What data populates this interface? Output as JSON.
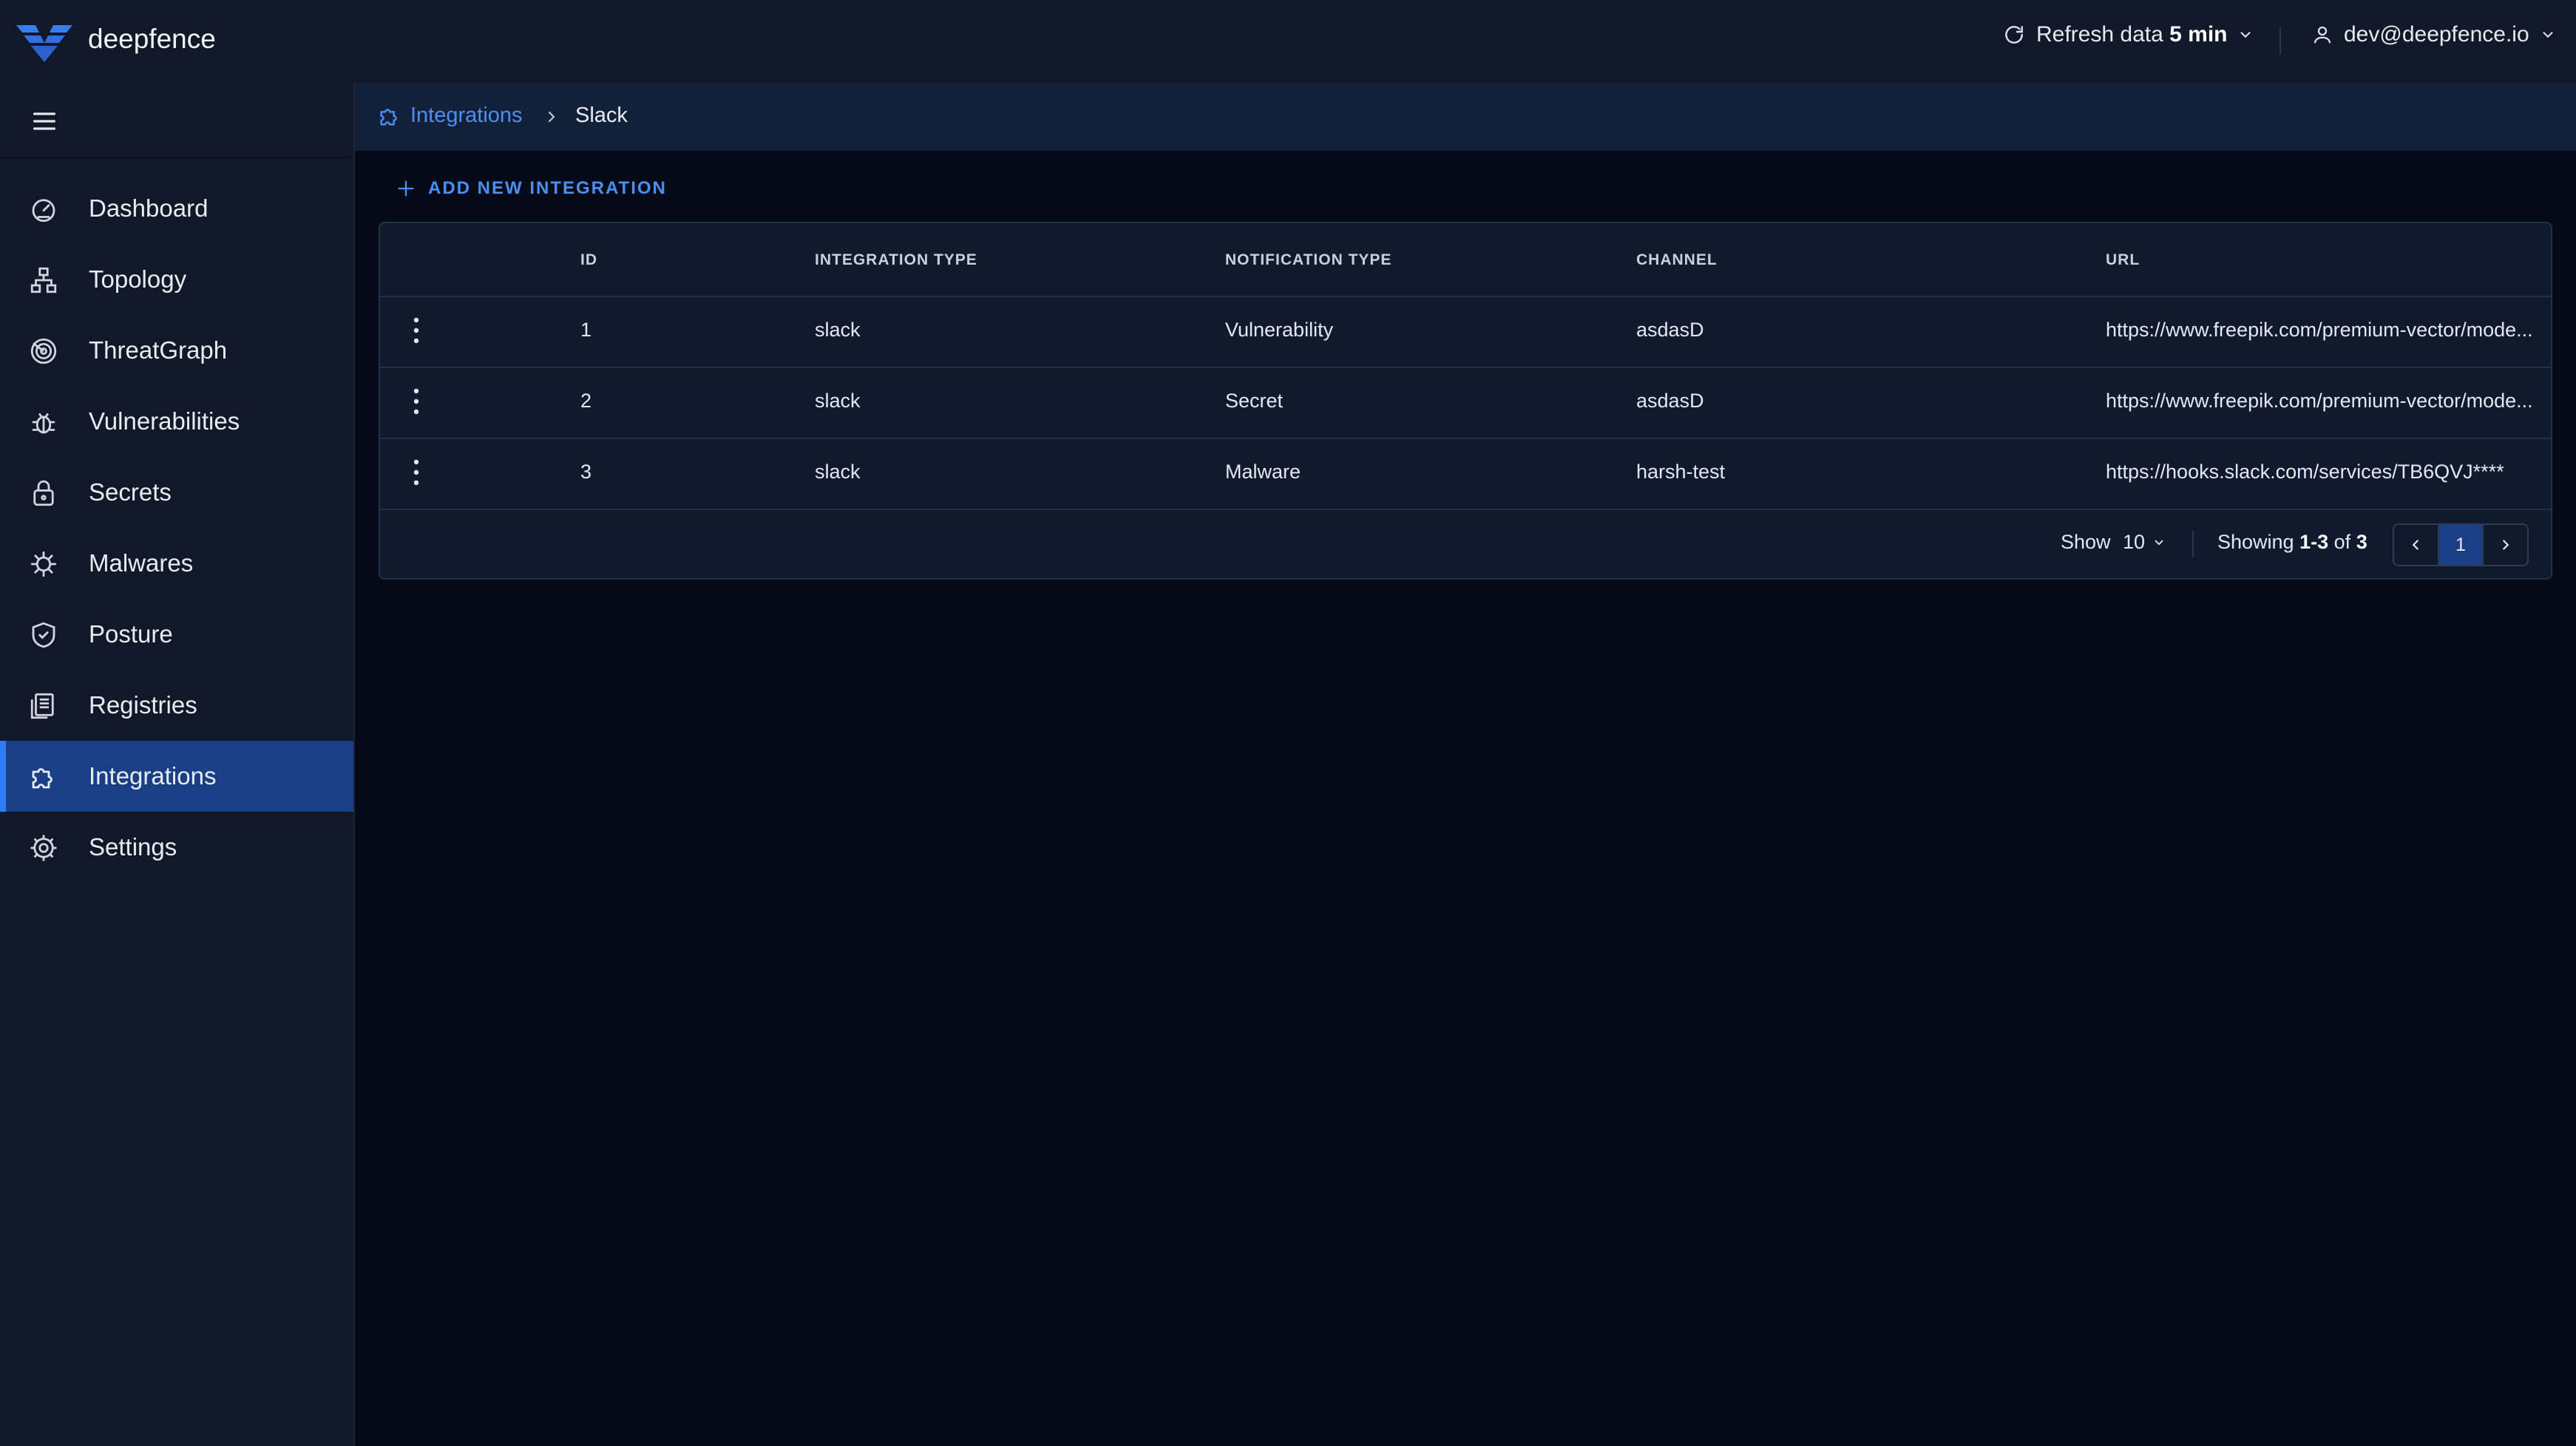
{
  "app": {
    "brand": "deepfence"
  },
  "topbar": {
    "refresh_label": "Refresh data",
    "refresh_value": "5 min",
    "user": "dev@deepfence.io"
  },
  "sidebar": {
    "items": [
      {
        "label": "Dashboard",
        "icon": "dashboard-icon"
      },
      {
        "label": "Topology",
        "icon": "topology-icon"
      },
      {
        "label": "ThreatGraph",
        "icon": "threatgraph-icon"
      },
      {
        "label": "Vulnerabilities",
        "icon": "bug-icon"
      },
      {
        "label": "Secrets",
        "icon": "lock-icon"
      },
      {
        "label": "Malwares",
        "icon": "virus-icon"
      },
      {
        "label": "Posture",
        "icon": "shield-icon"
      },
      {
        "label": "Registries",
        "icon": "registries-icon"
      },
      {
        "label": "Integrations",
        "icon": "puzzle-icon",
        "active": true
      },
      {
        "label": "Settings",
        "icon": "gear-icon"
      }
    ]
  },
  "breadcrumb": {
    "parent": "Integrations",
    "current": "Slack"
  },
  "actions": {
    "add_new": "ADD NEW INTEGRATION"
  },
  "table": {
    "headers": [
      "ID",
      "INTEGRATION TYPE",
      "NOTIFICATION TYPE",
      "CHANNEL",
      "URL"
    ],
    "rows": [
      {
        "id": "1",
        "integration_type": "slack",
        "notification_type": "Vulnerability",
        "channel": "asdasD",
        "url": "https://www.freepik.com/premium-vector/mode..."
      },
      {
        "id": "2",
        "integration_type": "slack",
        "notification_type": "Secret",
        "channel": "asdasD",
        "url": "https://www.freepik.com/premium-vector/mode..."
      },
      {
        "id": "3",
        "integration_type": "slack",
        "notification_type": "Malware",
        "channel": "harsh-test",
        "url": "https://hooks.slack.com/services/TB6QVJ****"
      }
    ]
  },
  "pagination": {
    "show_label": "Show",
    "page_size": "10",
    "showing_prefix": "Showing",
    "range": "1-3",
    "of_label": "of",
    "total": "3",
    "current_page": "1"
  },
  "colors": {
    "accent": "#2f7df6",
    "link": "#4b8ff5",
    "active_bg": "#1a3f86",
    "bg": "#050a19",
    "panel": "#111827"
  }
}
